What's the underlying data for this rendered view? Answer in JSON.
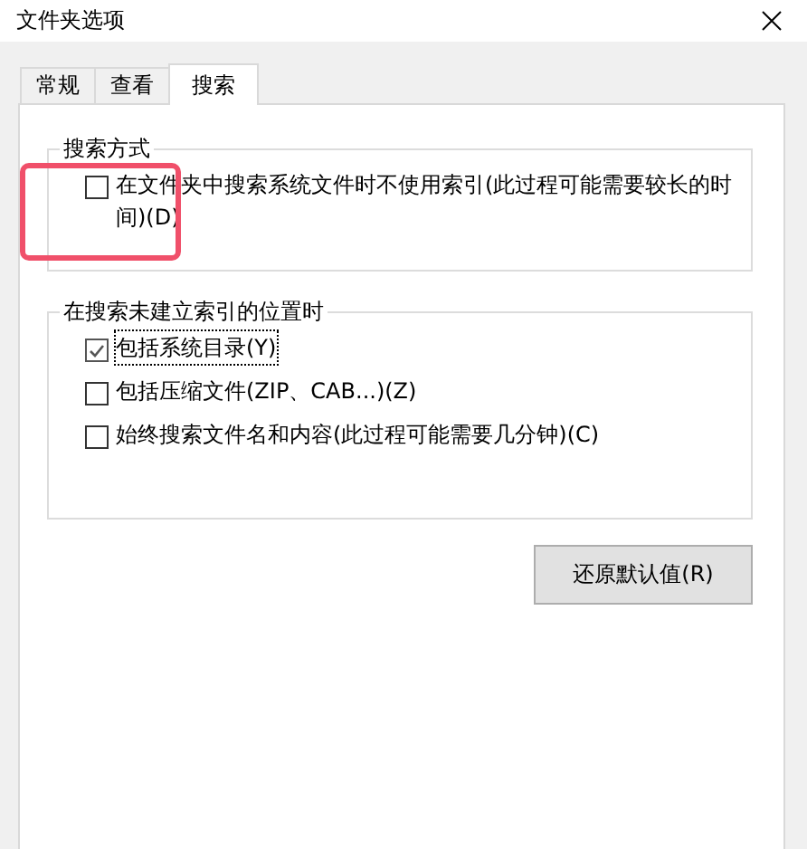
{
  "window": {
    "title": "文件夹选项"
  },
  "tabs": [
    {
      "label": "常规",
      "selected": false
    },
    {
      "label": "查看",
      "selected": false
    },
    {
      "label": "搜索",
      "selected": true
    }
  ],
  "groups": [
    {
      "title": "搜索方式",
      "options": [
        {
          "label": "在文件夹中搜索系统文件时不使用索引(此过程可能需要较长的时间)(D)",
          "checked": false,
          "focused": false,
          "highlighted": true
        }
      ]
    },
    {
      "title": "在搜索未建立索引的位置时",
      "options": [
        {
          "label": "包括系统目录(Y)",
          "checked": true,
          "focused": true,
          "highlighted": false
        },
        {
          "label": "包括压缩文件(ZIP、CAB...)(Z)",
          "checked": false,
          "focused": false,
          "highlighted": false
        },
        {
          "label": "始终搜索文件名和内容(此过程可能需要几分钟)(C)",
          "checked": false,
          "focused": false,
          "highlighted": false
        }
      ]
    }
  ],
  "buttons": [
    "还原默认值(R)"
  ]
}
